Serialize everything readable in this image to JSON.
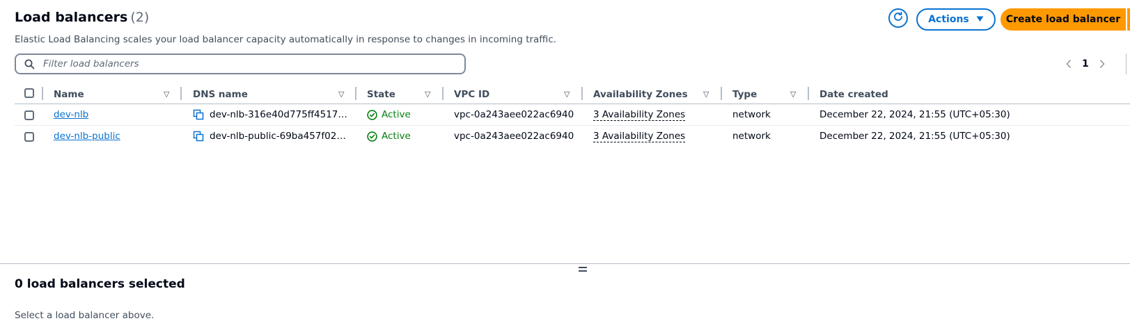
{
  "header": {
    "title": "Load balancers",
    "count": "(2)",
    "description": "Elastic Load Balancing scales your load balancer capacity automatically in response to changes in incoming traffic.",
    "actions_label": "Actions",
    "create_label": "Create load balancer",
    "refresh_icon": "refresh-icon"
  },
  "filter": {
    "placeholder": "Filter load balancers",
    "value": ""
  },
  "pagination": {
    "current_page": "1"
  },
  "table": {
    "columns": [
      "Name",
      "DNS name",
      "State",
      "VPC ID",
      "Availability Zones",
      "Type",
      "Date created"
    ],
    "rows": [
      {
        "name": "dev-nlb",
        "dns": "dev-nlb-316e40d775ff4517…",
        "state": "Active",
        "vpc": "vpc-0a243aee022ac6940",
        "az": "3 Availability Zones",
        "type": "network",
        "date": "December 22, 2024, 21:55 (UTC+05:30)"
      },
      {
        "name": "dev-nlb-public",
        "dns": "dev-nlb-public-69ba457f02…",
        "state": "Active",
        "vpc": "vpc-0a243aee022ac6940",
        "az": "3 Availability Zones",
        "type": "network",
        "date": "December 22, 2024, 21:55 (UTC+05:30)"
      }
    ]
  },
  "selection": {
    "title": "0 load balancers selected",
    "subtitle": "Select a load balancer above."
  },
  "colors": {
    "accent": "#0972d3",
    "primary_button": "#ff9900",
    "success": "#037f0c",
    "border": "#b6bec9"
  }
}
